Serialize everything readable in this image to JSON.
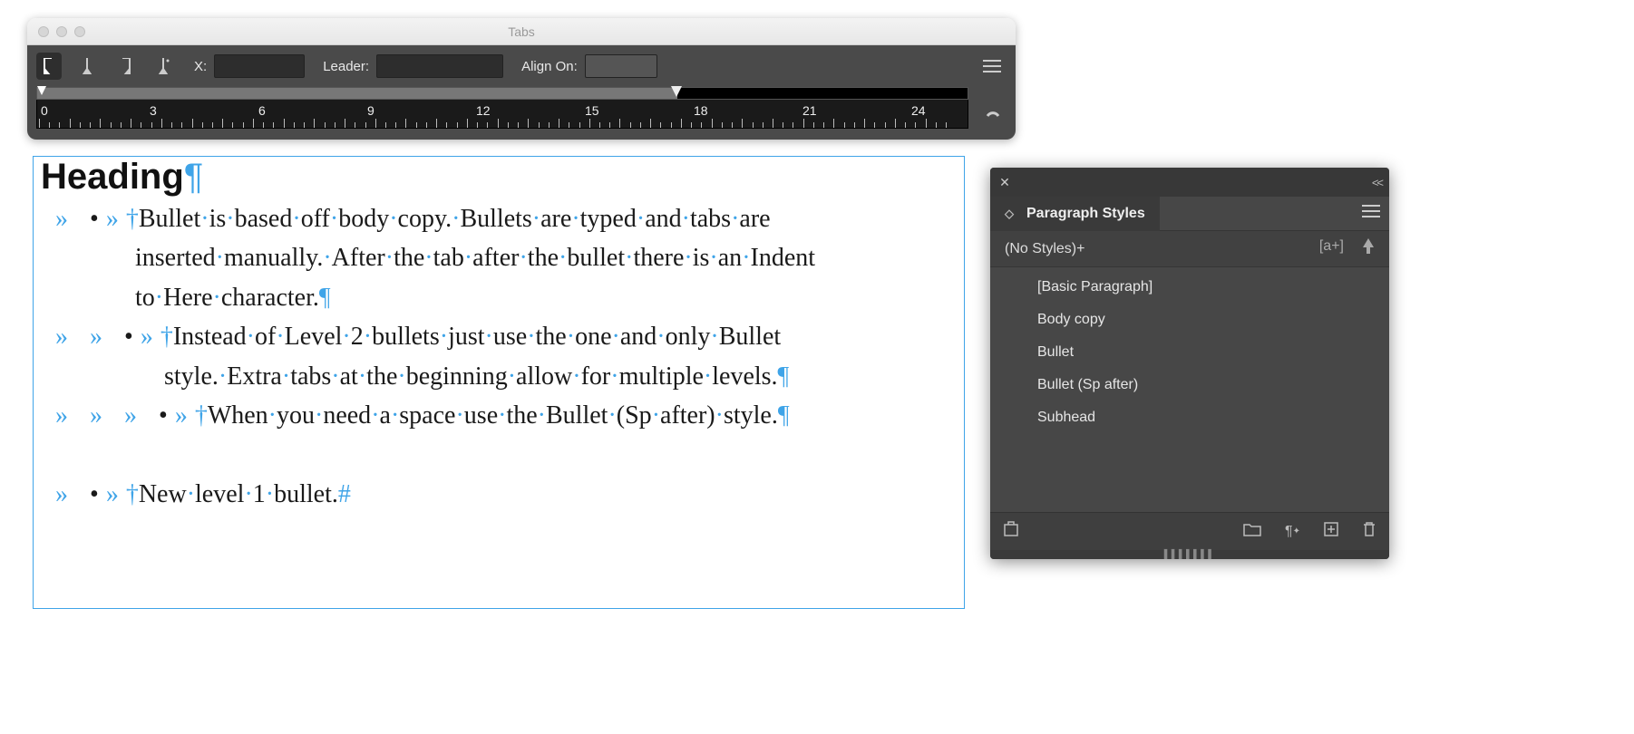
{
  "tabs_panel": {
    "title": "Tabs",
    "x_label": "X:",
    "x_value": "",
    "leader_label": "Leader:",
    "leader_value": "",
    "alignon_label": "Align On:",
    "alignon_value": "",
    "ruler_numbers": [
      "0",
      "3",
      "6",
      "9",
      "12",
      "15",
      "18",
      "21",
      "24"
    ]
  },
  "document": {
    "heading_text": "Heading",
    "bullet1": "Bullet is based off body copy. Bullets are typed and tabs are inserted manually. After the tab after the bullet there is an Indent to Here character.",
    "bullet2": "Instead of Level 2 bullets just use the one and only Bullet style. Extra tabs at the beginning allow for multiple levels.",
    "bullet3": "When you need a space use the Bullet (Sp after) style.",
    "bullet4": "New level 1 bullet."
  },
  "ps_panel": {
    "title": "Paragraph Styles",
    "current": "(No Styles)+",
    "ap_label": "[a+]",
    "items": [
      "[Basic Paragraph]",
      "Body copy",
      "Bullet",
      "Bullet (Sp after)",
      "Subhead"
    ]
  }
}
